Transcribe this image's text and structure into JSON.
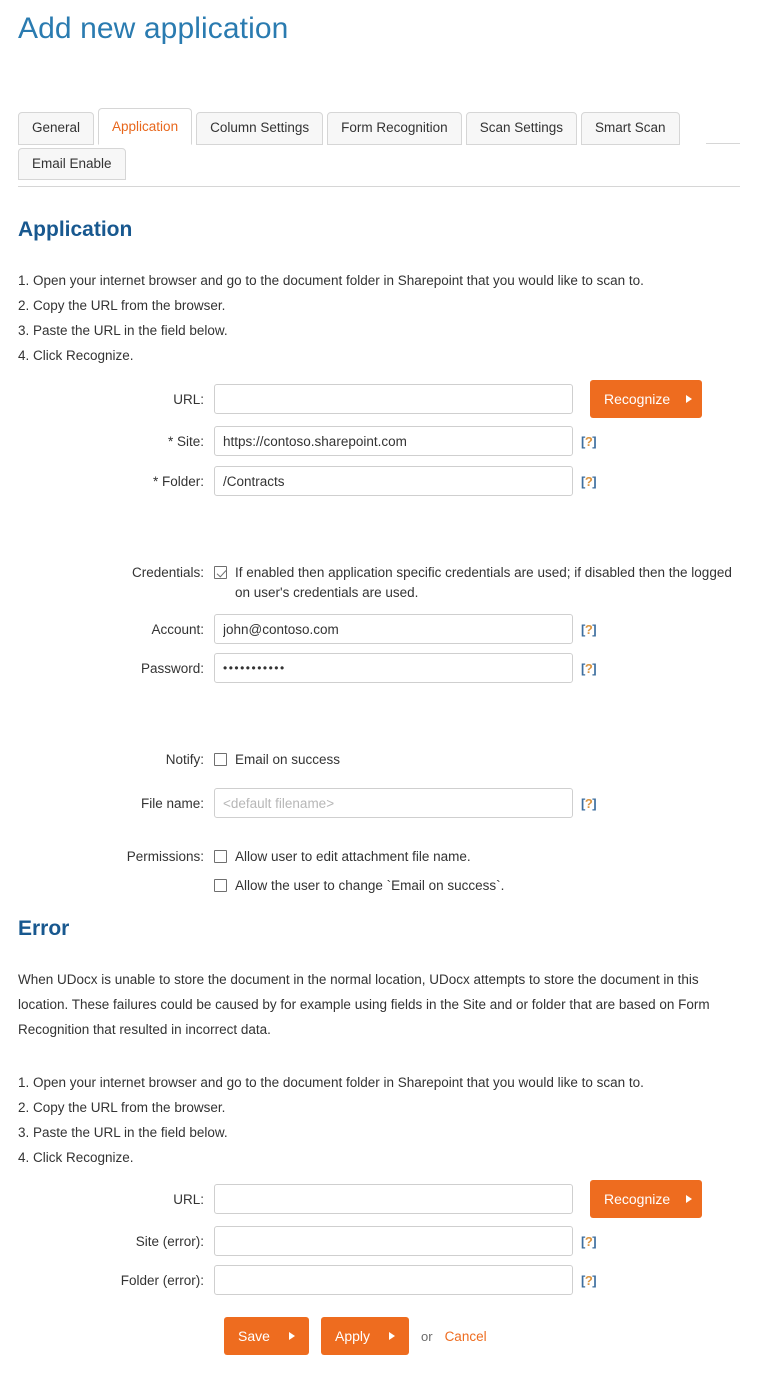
{
  "page": {
    "title": "Add new application"
  },
  "tabs": {
    "row1": [
      {
        "label": "General",
        "active": false
      },
      {
        "label": "Application",
        "active": true
      },
      {
        "label": "Column Settings",
        "active": false
      },
      {
        "label": "Form Recognition",
        "active": false
      },
      {
        "label": "Scan Settings",
        "active": false
      },
      {
        "label": "Smart Scan",
        "active": false
      }
    ],
    "row2": [
      {
        "label": "Email Enable",
        "active": false
      }
    ]
  },
  "application_section": {
    "heading": "Application",
    "steps": [
      "1. Open your internet browser and go to the document folder in Sharepoint that you would like to scan to.",
      "2. Copy the URL from the browser.",
      "3. Paste the URL in the field below.",
      "4. Click Recognize."
    ],
    "url_field": {
      "label": "URL:",
      "value": "",
      "placeholder": ""
    },
    "recognize_button": "Recognize",
    "site_field": {
      "label": "* Site:",
      "value": "https://contoso.sharepoint.com",
      "placeholder": ""
    },
    "folder_field": {
      "label": "* Folder:",
      "value": "/Contracts",
      "placeholder": ""
    },
    "credentials": {
      "label": "Credentials:",
      "checked": true,
      "text": "If enabled then application specific credentials are used; if disabled then the logged on user's credentials are used."
    },
    "account_field": {
      "label": "Account:",
      "value": "john@contoso.com",
      "placeholder": ""
    },
    "password_field": {
      "label": "Password:",
      "value": "•••••••••••",
      "placeholder": ""
    },
    "notify": {
      "label": "Notify:",
      "checked": false,
      "text": "Email on success"
    },
    "filename_field": {
      "label": "File name:",
      "value": "",
      "placeholder": "<default filename>"
    },
    "permissions": {
      "label": "Permissions:",
      "items": [
        {
          "checked": false,
          "text": "Allow user to edit attachment file name."
        },
        {
          "checked": false,
          "text": "Allow the user to change `Email on success`."
        }
      ]
    }
  },
  "error_section": {
    "heading": "Error",
    "paragraph": "When UDocx is unable to store the document in the normal location, UDocx attempts to store the document in this location. These failures could be caused by for example using fields in the Site and or folder that are based on Form Recognition that resulted in incorrect data.",
    "steps": [
      "1. Open your internet browser and go to the document folder in Sharepoint that you would like to scan to.",
      "2. Copy the URL from the browser.",
      "3. Paste the URL in the field below.",
      "4. Click Recognize."
    ],
    "url_field": {
      "label": "URL:",
      "value": "",
      "placeholder": ""
    },
    "recognize_button": "Recognize",
    "site_error_field": {
      "label": "Site (error):",
      "value": "",
      "placeholder": ""
    },
    "folder_error_field": {
      "label": "Folder (error):",
      "value": "",
      "placeholder": ""
    }
  },
  "footer": {
    "save_label": "Save",
    "apply_label": "Apply",
    "or_label": "or",
    "cancel_label": "Cancel"
  },
  "icons": {
    "help": "[?]",
    "help_bracket_left": "[",
    "help_bracket_right": "]",
    "help_question": "?"
  },
  "colors": {
    "accent_orange": "#ee6c1f",
    "title_blue": "#2a7bb0",
    "heading_blue": "#18588f",
    "border_grey": "#cfcfcf"
  }
}
